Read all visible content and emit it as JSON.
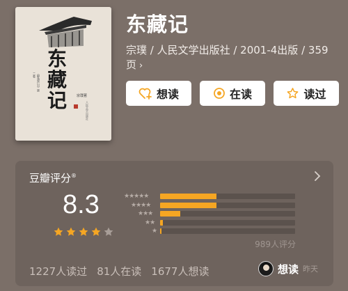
{
  "book": {
    "title": "东藏记",
    "meta": "宗璞 / 人民文学出版社 / 2001-4出版 / 359页",
    "cover": {
      "calligraphy": "东藏记",
      "series_label": "《野葫芦引》第二卷",
      "author": "宗璞著",
      "publisher": "人民文学出版社"
    }
  },
  "actions": [
    {
      "label": "想读",
      "icon": "heart-plus-icon"
    },
    {
      "label": "在读",
      "icon": "reading-dot-icon"
    },
    {
      "label": "读过",
      "icon": "star-outline-icon"
    }
  ],
  "rating": {
    "title": "豆瓣评分",
    "title_mark": "®",
    "score": "8.3",
    "stars": 4,
    "distribution": [
      {
        "stars": 5,
        "fraction": 0.42
      },
      {
        "stars": 4,
        "fraction": 0.42
      },
      {
        "stars": 3,
        "fraction": 0.15
      },
      {
        "stars": 2,
        "fraction": 0.02
      },
      {
        "stars": 1,
        "fraction": 0.01
      }
    ],
    "count": "989人评分",
    "stats": [
      "1227人读过",
      "81人在读",
      "1677人想读"
    ],
    "friend": {
      "action": "想读",
      "time": "昨天"
    }
  },
  "colors": {
    "background": "#7b6f68",
    "panel": "#6e635d",
    "accent": "#f5a623",
    "bar_track": "#5b524d"
  }
}
